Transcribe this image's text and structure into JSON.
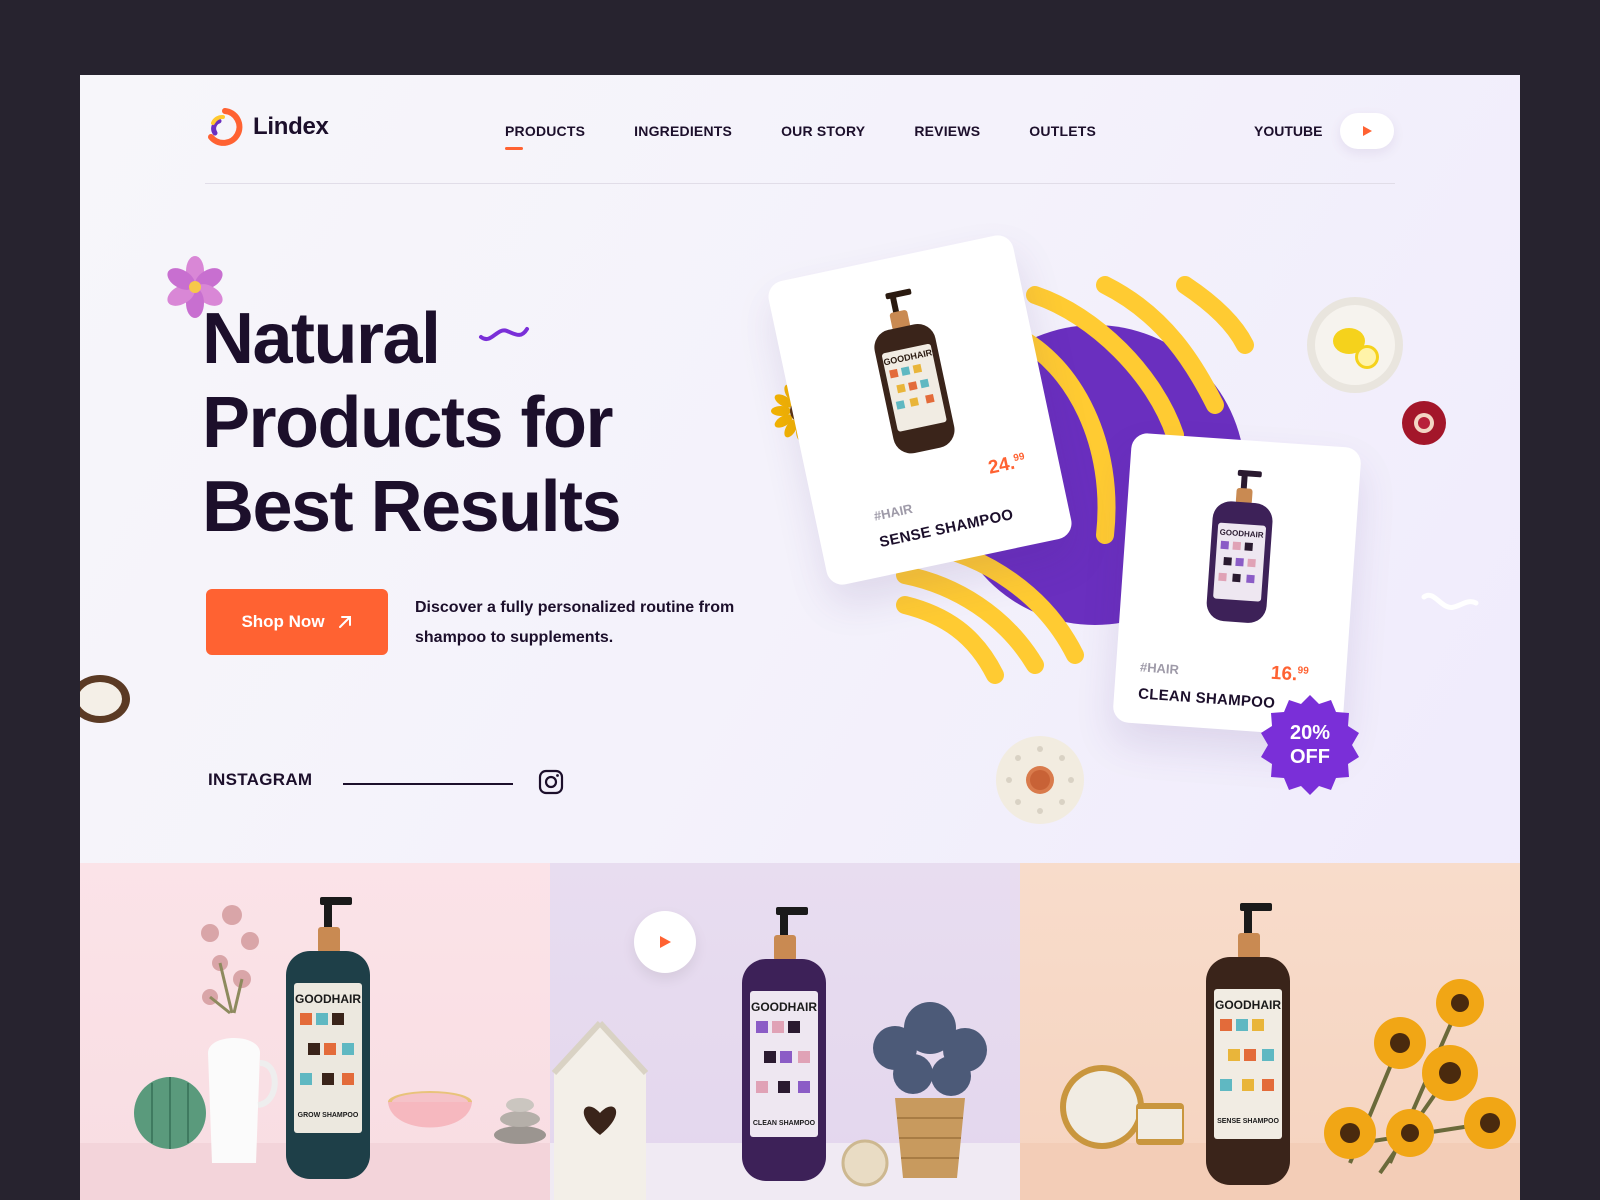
{
  "brand": {
    "name": "Lindex",
    "accent": "#ff6232",
    "purple": "#6a2fbf",
    "dark": "#1c0f2b"
  },
  "nav": {
    "items": [
      {
        "label": "PRODUCTS",
        "active": true
      },
      {
        "label": "INGREDIENTS"
      },
      {
        "label": "OUR STORY"
      },
      {
        "label": "REVIEWS"
      },
      {
        "label": "OUTLETS"
      }
    ],
    "youtube_label": "YOUTUBE",
    "youtube_icon": "play-icon"
  },
  "hero": {
    "title_line1": "Natural",
    "title_line2": "Products for",
    "title_line3": "Best Results",
    "cta_label": "Shop Now",
    "cta_icon": "arrow-up-right-icon",
    "description": "Discover a fully personalized routine from shampoo to supplements.",
    "instagram_label": "INSTAGRAM",
    "instagram_icon": "instagram-icon"
  },
  "products": [
    {
      "tag": "#HAIR",
      "name": "SENSE SHAMPOO",
      "price_main": "24.",
      "price_cents": "99",
      "bottle_color": "#3a241a",
      "bottle_label": "GOODHAIR"
    },
    {
      "tag": "#HAIR",
      "name": "CLEAN SHAMPOO",
      "price_main": "16.",
      "price_cents": "99",
      "bottle_color": "#3d2158",
      "bottle_label": "GOODHAIR"
    }
  ],
  "badge": {
    "line1": "20%",
    "line2": "OFF",
    "color": "#7a2fd8"
  },
  "panels": [
    {
      "bottle_label": "GOODHAIR",
      "product": "GROW SHAMPOO",
      "bottle_color": "#1e3f48"
    },
    {
      "bottle_label": "GOODHAIR",
      "product": "CLEAN SHAMPOO",
      "bottle_color": "#3d2158",
      "play_icon": "play-icon"
    },
    {
      "bottle_label": "GOODHAIR",
      "product": "SENSE SHAMPOO",
      "bottle_color": "#3a241a"
    }
  ]
}
